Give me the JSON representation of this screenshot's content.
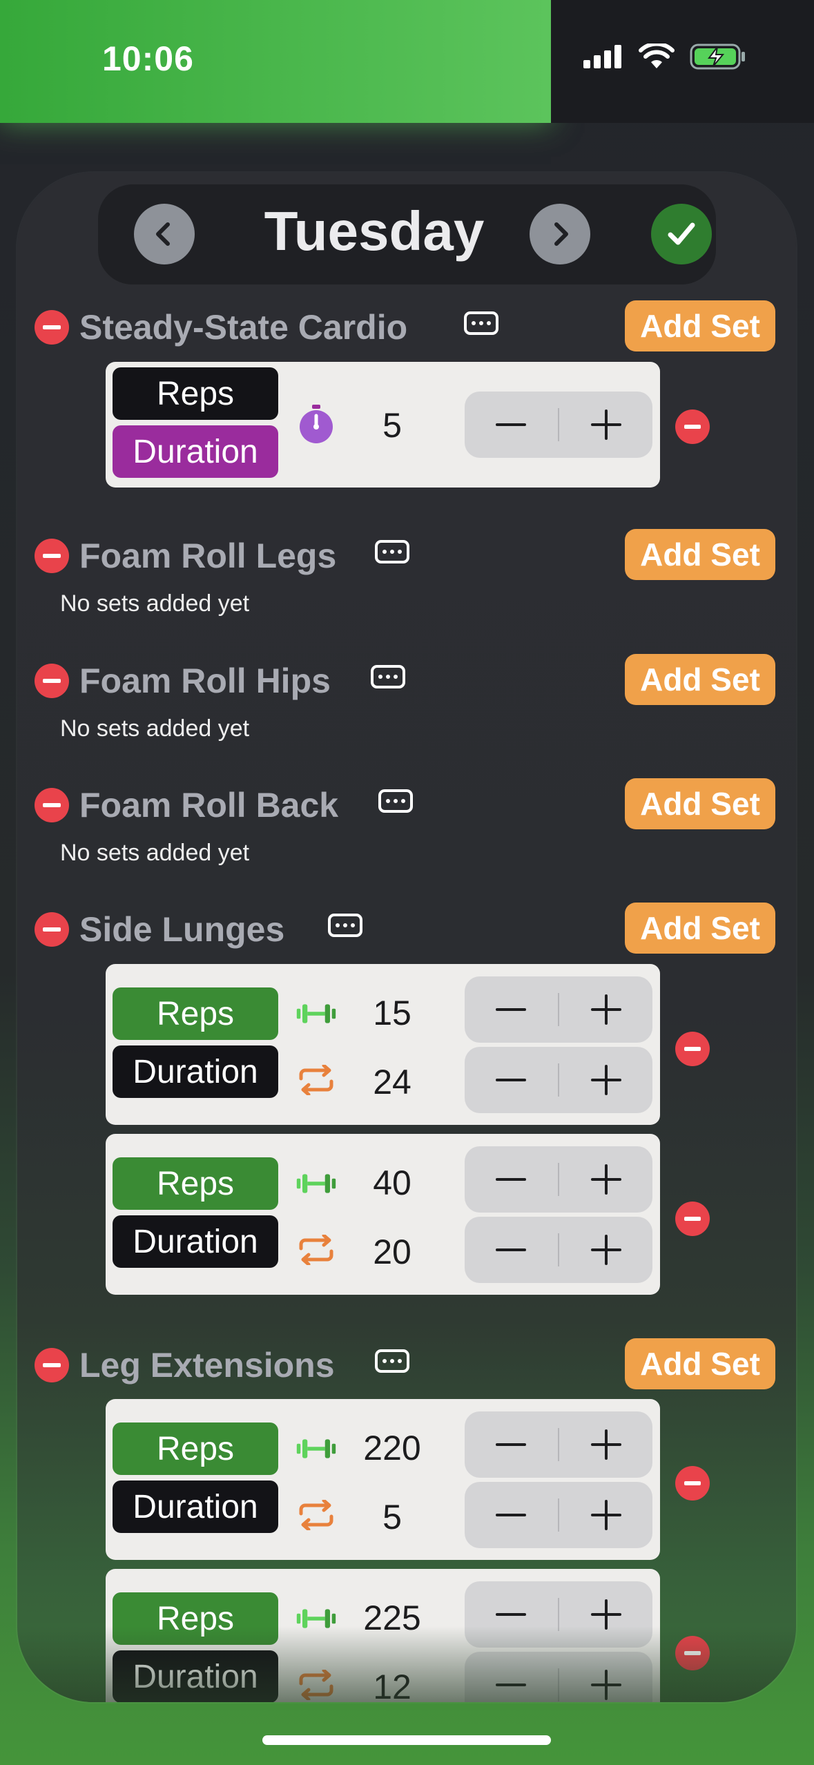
{
  "status_bar": {
    "time": "10:06"
  },
  "header": {
    "day": "Tuesday"
  },
  "labels": {
    "add_set": "Add Set",
    "empty": "No sets added yet",
    "reps": "Reps",
    "duration": "Duration"
  },
  "colors": {
    "accent_orange": "#f0a14a",
    "remove_red": "#e9434b",
    "active_green": "#3a8b34",
    "active_purple": "#9a2c9d",
    "done_green": "#2f7d2f"
  },
  "exercises": [
    {
      "name": "Steady-State Cardio",
      "sets": [
        {
          "active_mode": "Duration",
          "icon": "timer-icon",
          "value": "5"
        }
      ]
    },
    {
      "name": "Foam Roll Legs",
      "sets": []
    },
    {
      "name": "Foam Roll Hips",
      "sets": []
    },
    {
      "name": "Foam Roll Back",
      "sets": []
    },
    {
      "name": "Side Lunges",
      "sets": [
        {
          "active_mode": "Reps",
          "reps": "15",
          "duration": "24"
        },
        {
          "active_mode": "Reps",
          "reps": "40",
          "duration": "20"
        }
      ]
    },
    {
      "name": "Leg Extensions",
      "sets": [
        {
          "active_mode": "Reps",
          "reps": "220",
          "duration": "5"
        },
        {
          "active_mode": "Reps",
          "reps": "225",
          "duration": "12"
        }
      ]
    }
  ]
}
